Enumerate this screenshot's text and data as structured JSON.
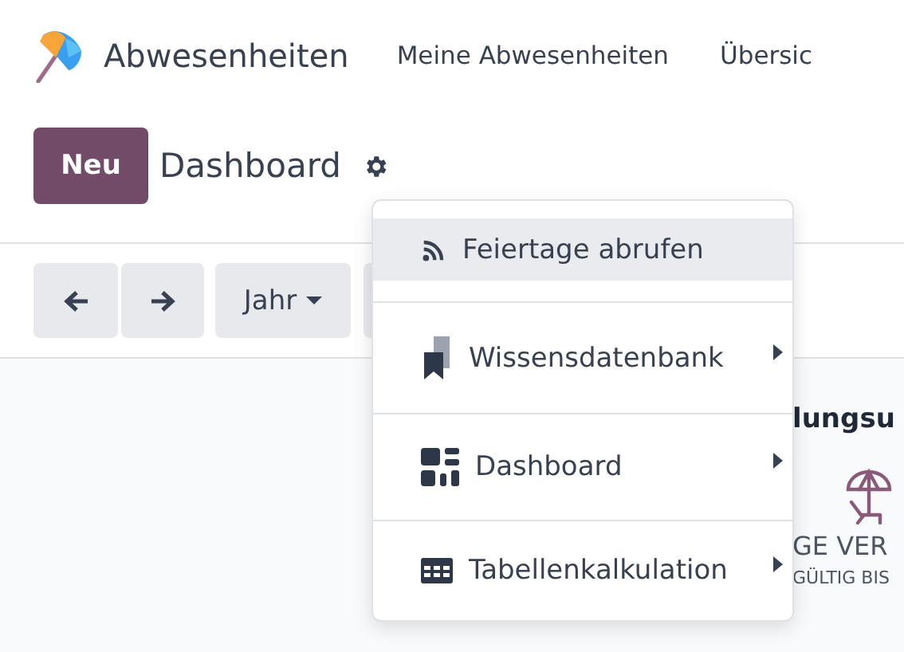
{
  "navbar": {
    "app_name": "Abwesenheiten",
    "menu": [
      "Meine Abwesenheiten",
      "Übersic"
    ]
  },
  "control_panel": {
    "new_button": "Neu",
    "title": "Dashboard"
  },
  "toolbar": {
    "year_button": "Jahr"
  },
  "dropdown": {
    "items": [
      {
        "kind": "rss",
        "label": "Feiertage abrufen",
        "selected": true,
        "submenu": false
      },
      {
        "kind": "knowledge",
        "label": "Wissensdatenbank",
        "selected": false,
        "submenu": true
      },
      {
        "kind": "dashboard",
        "label": "Dashboard",
        "selected": false,
        "submenu": true
      },
      {
        "kind": "table",
        "label": "Tabellenkalkulation",
        "selected": false,
        "submenu": true
      }
    ]
  },
  "summary_card": {
    "heading": "lungsu",
    "value": "GE VER",
    "note": "GÜLTIG BIS"
  }
}
